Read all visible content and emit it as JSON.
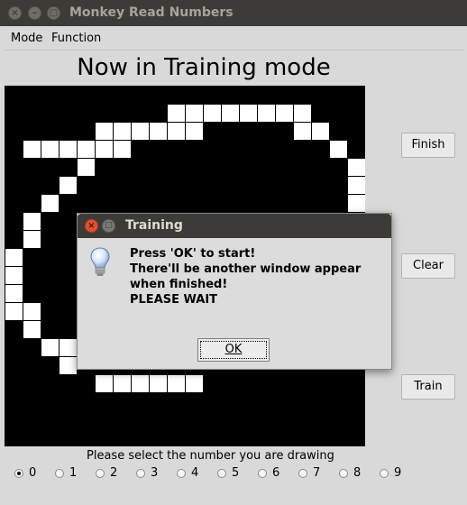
{
  "window": {
    "title": "Monkey Read Numbers"
  },
  "menu": {
    "items": [
      {
        "label": "Mode"
      },
      {
        "label": "Function"
      }
    ]
  },
  "heading": "Now in Training mode",
  "buttons": {
    "finish": "Finish",
    "clear": "Clear",
    "train": "Train"
  },
  "prompt": "Please select the number you are drawing",
  "digits": {
    "selected": "0",
    "options": [
      "0",
      "1",
      "2",
      "3",
      "4",
      "5",
      "6",
      "7",
      "8",
      "9"
    ]
  },
  "dialog": {
    "title": "Training",
    "lines": [
      "Press 'OK' to start!",
      "There'll be another window appear",
      "when finished!",
      "PLEASE WAIT"
    ],
    "ok_label": "OK",
    "icon": "lightbulb-icon"
  },
  "colors": {
    "titlebar": "#3c3b37",
    "close": "#e0522f",
    "canvas": "#000000",
    "stroke": "#ffffff"
  }
}
